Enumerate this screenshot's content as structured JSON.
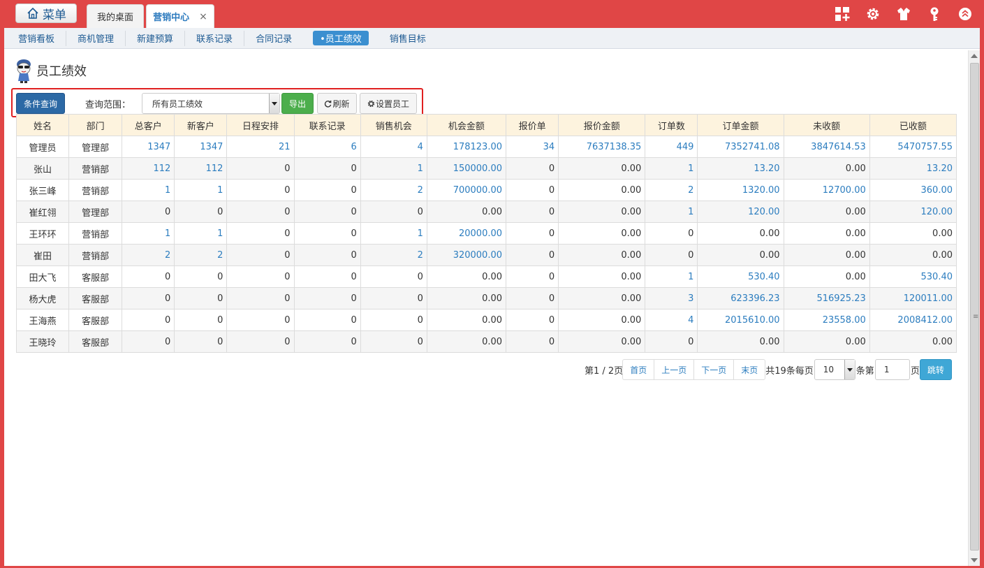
{
  "header": {
    "menu_label": "菜单",
    "tabs": [
      {
        "label": "我的桌面"
      },
      {
        "label": "营销中心",
        "close": "×"
      }
    ],
    "right_icons": [
      "grid-plus-icon",
      "gear-icon",
      "shirt-icon",
      "key-icon",
      "collapse-up-icon"
    ]
  },
  "subnav": {
    "items": [
      "营销看板",
      "商机管理",
      "新建预算",
      "联系记录",
      "合同记录",
      "•员工绩效",
      "销售目标"
    ],
    "active_index": 5
  },
  "page": {
    "title": "员工绩效"
  },
  "toolbar": {
    "query_button": "条件查询",
    "scope_label": "查询范围：",
    "scope_value": "所有员工绩效",
    "export_button": "导出",
    "refresh_button": "刷新",
    "setup_button": "设置员工"
  },
  "table": {
    "columns": [
      "姓名",
      "部门",
      "总客户",
      "新客户",
      "日程安排",
      "联系记录",
      "销售机会",
      "机会金额",
      "报价单",
      "报价金额",
      "订单数",
      "订单金额",
      "未收额",
      "已收额"
    ],
    "rows": [
      [
        "管理员",
        "管理部",
        "1347",
        "1347",
        "21",
        "6",
        "4",
        "178123.00",
        "34",
        "7637138.35",
        "449",
        "7352741.08",
        "3847614.53",
        "5470757.55"
      ],
      [
        "张山",
        "营销部",
        "112",
        "112",
        "0",
        "0",
        "1",
        "150000.00",
        "0",
        "0.00",
        "1",
        "13.20",
        "0.00",
        "13.20"
      ],
      [
        "张三峰",
        "营销部",
        "1",
        "1",
        "0",
        "0",
        "2",
        "700000.00",
        "0",
        "0.00",
        "2",
        "1320.00",
        "12700.00",
        "360.00"
      ],
      [
        "崔红翎",
        "管理部",
        "0",
        "0",
        "0",
        "0",
        "0",
        "0.00",
        "0",
        "0.00",
        "1",
        "120.00",
        "0.00",
        "120.00"
      ],
      [
        "王环环",
        "营销部",
        "1",
        "1",
        "0",
        "0",
        "1",
        "20000.00",
        "0",
        "0.00",
        "0",
        "0.00",
        "0.00",
        "0.00"
      ],
      [
        "崔田",
        "营销部",
        "2",
        "2",
        "0",
        "0",
        "2",
        "320000.00",
        "0",
        "0.00",
        "0",
        "0.00",
        "0.00",
        "0.00"
      ],
      [
        "田大飞",
        "客服部",
        "0",
        "0",
        "0",
        "0",
        "0",
        "0.00",
        "0",
        "0.00",
        "1",
        "530.40",
        "0.00",
        "530.40"
      ],
      [
        "杨大虎",
        "客服部",
        "0",
        "0",
        "0",
        "0",
        "0",
        "0.00",
        "0",
        "0.00",
        "3",
        "623396.23",
        "516925.23",
        "120011.00"
      ],
      [
        "王海燕",
        "客服部",
        "0",
        "0",
        "0",
        "0",
        "0",
        "0.00",
        "0",
        "0.00",
        "4",
        "2015610.00",
        "23558.00",
        "2008412.00"
      ],
      [
        "王晓玲",
        "客服部",
        "0",
        "0",
        "0",
        "0",
        "0",
        "0.00",
        "0",
        "0.00",
        "0",
        "0.00",
        "0.00",
        "0.00"
      ]
    ]
  },
  "pager": {
    "page_info": "第1 / 2页",
    "first": "首页",
    "prev": "上一页",
    "next": "下一页",
    "last": "末页",
    "total_text": "共19条每页",
    "page_size": "10",
    "goto_prefix": "条第",
    "goto_value": "1",
    "goto_suffix": "页",
    "jump_button": "跳转"
  },
  "colors": {
    "header_red": "#e04646",
    "link_blue": "#2c7dbf",
    "query_blue": "#2c69a5",
    "export_green": "#4cae4c",
    "header_row": "#fdf3de",
    "highlight_border": "#e02020"
  }
}
